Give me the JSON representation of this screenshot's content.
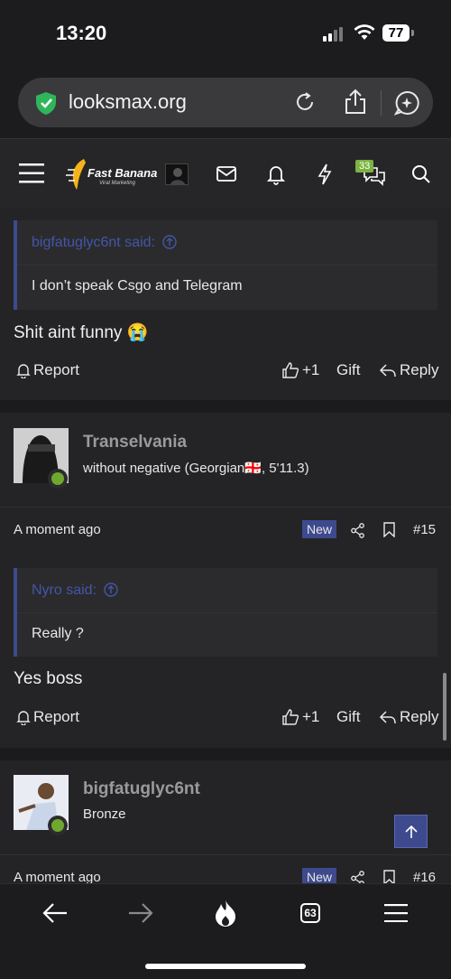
{
  "status": {
    "time": "13:20",
    "battery": "77"
  },
  "browser": {
    "url": "looksmax.org",
    "tab_count": "63"
  },
  "header": {
    "brand": "Fast Banana",
    "brand_sub": "Viral Marketing",
    "chat_badge": "33"
  },
  "posts": [
    {
      "quote_author": "bigfatuglyc6nt said:",
      "quote_text": "I don’t speak Csgo and Telegram",
      "message": "Shit aint funny 😭",
      "actions": {
        "report": "Report",
        "like": "+1",
        "gift": "Gift",
        "reply": "Reply"
      }
    },
    {
      "username": "Transelvania",
      "user_title": "without negative (Georgian🇬🇪, 5'11.3)",
      "time": "A moment ago",
      "new_label": "New",
      "number": "#15",
      "quote_author": "Nyro said:",
      "quote_text": "Really ?",
      "message": "Yes boss",
      "actions": {
        "report": "Report",
        "like": "+1",
        "gift": "Gift",
        "reply": "Reply"
      }
    },
    {
      "username": "bigfatuglyc6nt",
      "user_title": "Bronze",
      "time": "A moment ago",
      "new_label": "New",
      "number": "#16"
    }
  ],
  "colors": {
    "accent": "#3d4a8e",
    "online": "#6ea82f",
    "badge": "#7cb342"
  }
}
